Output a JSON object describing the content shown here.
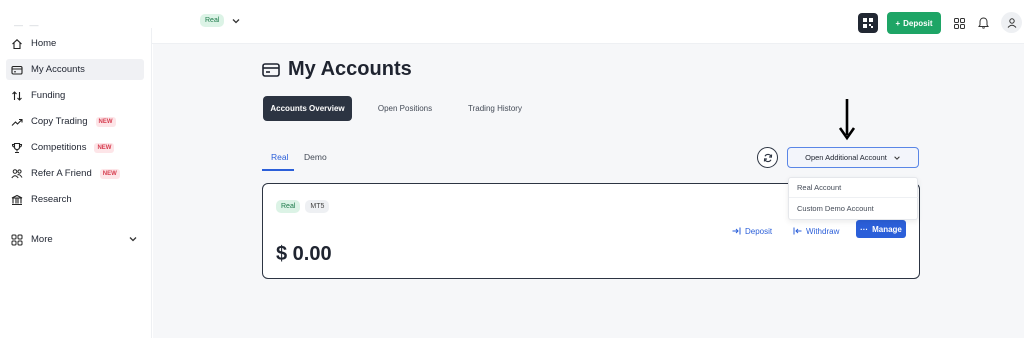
{
  "topbar": {
    "account_type": "Real",
    "deposit_label": "Deposit",
    "icons": [
      "qr-code-icon",
      "grid-apps-icon",
      "bell-icon",
      "user-icon"
    ]
  },
  "sidebar": {
    "items": [
      {
        "label": "Home",
        "icon": "home-icon"
      },
      {
        "label": "My Accounts",
        "icon": "wallet-icon"
      },
      {
        "label": "Funding",
        "icon": "swap-arrows-icon"
      },
      {
        "label": "Copy Trading",
        "icon": "trending-up-icon",
        "badge": "NEW"
      },
      {
        "label": "Competitions",
        "icon": "trophy-icon",
        "badge": "NEW"
      },
      {
        "label": "Refer A Friend",
        "icon": "people-icon",
        "badge": "NEW"
      },
      {
        "label": "Research",
        "icon": "building-icon"
      }
    ],
    "more_label": "More"
  },
  "page": {
    "title": "My Accounts",
    "tabs": [
      "Accounts Overview",
      "Open Positions",
      "Trading History"
    ],
    "subtabs": [
      "Real",
      "Demo"
    ],
    "open_account_label": "Open Additional Account",
    "dropdown": [
      "Real Account",
      "Custom Demo Account"
    ]
  },
  "account_card": {
    "type_badge": "Real",
    "platform_badge": "MT5",
    "balance": "$ 0.00",
    "actions": {
      "deposit": "Deposit",
      "withdraw": "Withdraw",
      "manage": "Manage"
    }
  },
  "colors": {
    "accent_green": "#1ea566",
    "accent_blue": "#2b5fd9",
    "dark": "#2c3442",
    "badge_new": "#d63d4f"
  }
}
